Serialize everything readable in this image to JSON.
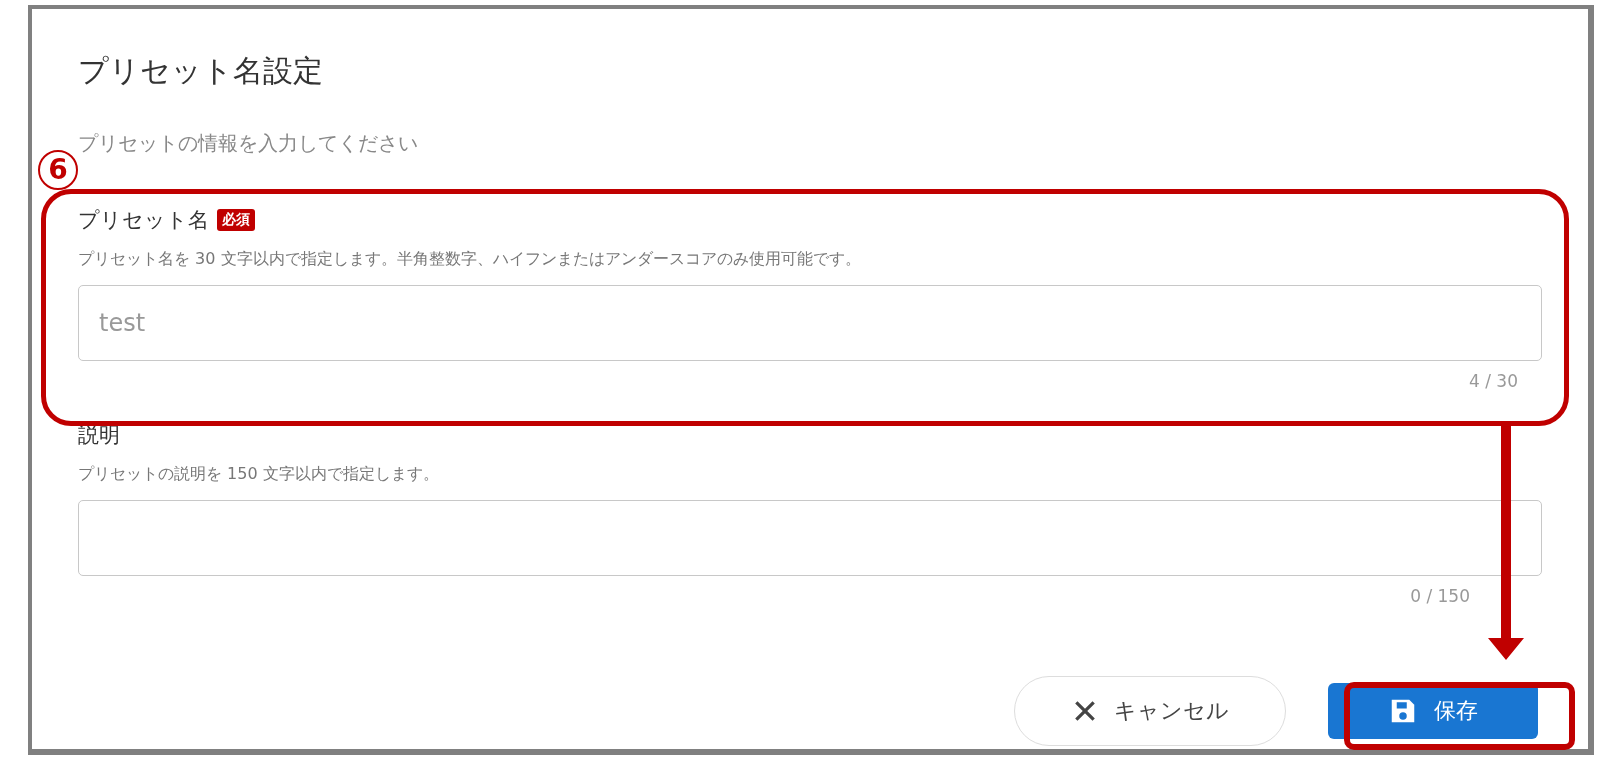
{
  "dialog": {
    "title": "プリセット名設定",
    "subtitle": "プリセットの情報を入力してください",
    "fields": [
      {
        "label": "プリセット名",
        "required": true,
        "required_badge": "必須",
        "hint": "プリセット名を 30 文字以内で指定します。半角整数字、ハイフンまたはアンダースコアのみ使用可能です。",
        "value": "test",
        "counter": "4 / 30"
      },
      {
        "label": "説明",
        "hint": "プリセットの説明を 150 文字以内で指定します。",
        "counter": "0 / 150"
      }
    ],
    "buttons": [
      {
        "kind": "cancel",
        "label": "キャンセル"
      },
      {
        "kind": "save",
        "label": "保存"
      }
    ]
  },
  "annotation": {
    "step": "6"
  }
}
